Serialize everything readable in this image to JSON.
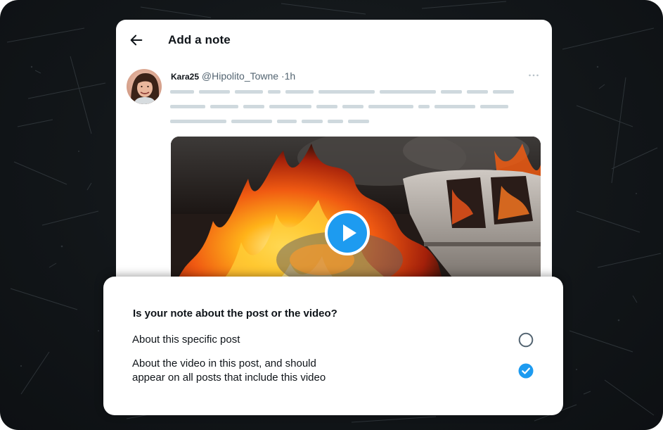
{
  "header": {
    "title": "Add a note",
    "back_icon": "arrow-left-icon"
  },
  "post": {
    "author_name": "Kara25",
    "author_handle": "@Hipolito_Towne",
    "separator": "·",
    "time": "1h",
    "more_icon": "more-horizontal-icon",
    "text_placeholder_lines": 3,
    "media": {
      "type": "video",
      "description_icon": "play-icon"
    }
  },
  "sheet": {
    "question": "Is your note about the post or the video?",
    "options": [
      {
        "label": "About this specific post",
        "selected": false
      },
      {
        "label_line1": "About the video in this post, and should",
        "label_line2": "appear on all posts that include this video",
        "selected": true
      }
    ]
  },
  "colors": {
    "accent": "#1d9bf0",
    "text_primary": "#0f1419",
    "text_secondary": "#536471",
    "placeholder": "#cfd9de",
    "background": "#121619"
  }
}
